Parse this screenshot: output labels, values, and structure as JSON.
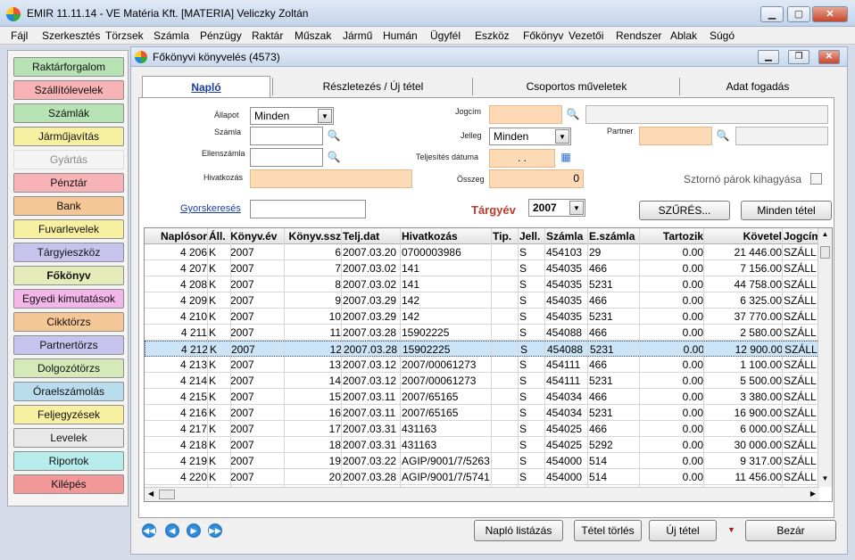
{
  "window": {
    "title": "EMIR 11.11.14 - VE Matéria Kft. [MATERIA] Veliczky Zoltán"
  },
  "menu": [
    "Fájl",
    "Szerkesztés",
    "Törzsek",
    "Számla",
    "Pénzügy",
    "Raktár",
    "Műszak",
    "Jármű",
    "Humán",
    "Ügyfél",
    "Eszköz",
    "Főkönyv",
    "Vezetői",
    "Rendszer",
    "Ablak",
    "Súgó"
  ],
  "nav": [
    {
      "label": "Raktárforgalom",
      "color": "#b7e3b4",
      "bold": false
    },
    {
      "label": "Szállítólevelek",
      "color": "#f7b3b6",
      "bold": false
    },
    {
      "label": "Számlák",
      "color": "#b7e3b4",
      "bold": false
    },
    {
      "label": "Járműjavítás",
      "color": "#f6f0a0",
      "bold": false
    },
    {
      "label": "Gyártás",
      "color": "#f4f4f4",
      "bold": false
    },
    {
      "label": "Pénztár",
      "color": "#f7b3b6",
      "bold": false
    },
    {
      "label": "Bank",
      "color": "#f5c796",
      "bold": false
    },
    {
      "label": "Fuvarlevelek",
      "color": "#f6f0a0",
      "bold": false
    },
    {
      "label": "Tárgyieszköz",
      "color": "#c8c3ec",
      "bold": false
    },
    {
      "label": "Főkönyv",
      "color": "#e6ecb9",
      "bold": true
    },
    {
      "label": "Egyedi kimutatások",
      "color": "#f3b6e9",
      "bold": false
    },
    {
      "label": "Cikktörzs",
      "color": "#f5c796",
      "bold": false
    },
    {
      "label": "Partnertörzs",
      "color": "#c8c3ec",
      "bold": false
    },
    {
      "label": "Dolgozótörzs",
      "color": "#d5eab8",
      "bold": false
    },
    {
      "label": "Óraelszámolás",
      "color": "#b9dded",
      "bold": false
    },
    {
      "label": "Feljegyzések",
      "color": "#f6f0a0",
      "bold": false
    },
    {
      "label": "Levelek",
      "color": "#e8e8e8",
      "bold": false
    },
    {
      "label": "Riportok",
      "color": "#b6ecec",
      "bold": false
    },
    {
      "label": "Kilépés",
      "color": "#f39898",
      "bold": false
    }
  ],
  "child": {
    "title": "Főkönyvi könyvelés (4573)"
  },
  "tabs": [
    "Napló",
    "Részletezés / Új tétel",
    "Csoportos  műveletek",
    "Adat fogadás"
  ],
  "form": {
    "allapot_label": "Állapot",
    "allapot_value": "Minden",
    "szamla_label": "Számla",
    "ellenszamla_label": "Ellenszámla",
    "hivatkozas_label": "Hivatkozás",
    "jogcim_label": "Jogcím",
    "jelleg_label": "Jelleg",
    "jelleg_value": "Minden",
    "teljesites_label": "Teljesítés dátuma",
    "teljesites_value": ". .",
    "osszeg_label": "Összeg",
    "osszeg_value": "0",
    "partner_label": "Partner",
    "sztorno_label": "Sztornó párok kihagyása",
    "gyorskereses": "Gyorskeresés",
    "targyev_label": "Tárgyév",
    "targyev_value": "2007",
    "szures_btn": "SZŰRÉS...",
    "minden_btn": "Minden tétel"
  },
  "grid": {
    "headers": [
      "Naplósor",
      "Áll.",
      "Könyv.év",
      "Könyv.ssz",
      "Telj.dat",
      "Hivatkozás",
      "Tip.",
      "Jell.",
      "Számla",
      "E.számla",
      "Tartozik",
      "Követel",
      "Jogcím"
    ],
    "rows": [
      [
        "4 206",
        "K",
        "2007",
        "6",
        "2007.03.20",
        "0700003986",
        "",
        "S",
        "454103",
        "29",
        "0.00",
        "21 446.00",
        "SZÁLL"
      ],
      [
        "4 207",
        "K",
        "2007",
        "7",
        "2007.03.02",
        "141",
        "",
        "S",
        "454035",
        "466",
        "0.00",
        "7 156.00",
        "SZÁLL"
      ],
      [
        "4 208",
        "K",
        "2007",
        "8",
        "2007.03.02",
        "141",
        "",
        "S",
        "454035",
        "5231",
        "0.00",
        "44 758.00",
        "SZÁLL"
      ],
      [
        "4 209",
        "K",
        "2007",
        "9",
        "2007.03.29",
        "142",
        "",
        "S",
        "454035",
        "466",
        "0.00",
        "6 325.00",
        "SZÁLL"
      ],
      [
        "4 210",
        "K",
        "2007",
        "10",
        "2007.03.29",
        "142",
        "",
        "S",
        "454035",
        "5231",
        "0.00",
        "37 770.00",
        "SZÁLL"
      ],
      [
        "4 211",
        "K",
        "2007",
        "11",
        "2007.03.28",
        "15902225",
        "",
        "S",
        "454088",
        "466",
        "0.00",
        "2 580.00",
        "SZÁLL"
      ],
      [
        "4 212",
        "K",
        "2007",
        "12",
        "2007.03.28",
        "15902225",
        "",
        "S",
        "454088",
        "5231",
        "0.00",
        "12 900.00",
        "SZÁLL"
      ],
      [
        "4 213",
        "K",
        "2007",
        "13",
        "2007.03.12",
        "2007/00061273",
        "",
        "S",
        "454111",
        "466",
        "0.00",
        "1 100.00",
        "SZÁLL"
      ],
      [
        "4 214",
        "K",
        "2007",
        "14",
        "2007.03.12",
        "2007/00061273",
        "",
        "S",
        "454111",
        "5231",
        "0.00",
        "5 500.00",
        "SZÁLL"
      ],
      [
        "4 215",
        "K",
        "2007",
        "15",
        "2007.03.11",
        "2007/65165",
        "",
        "S",
        "454034",
        "466",
        "0.00",
        "3 380.00",
        "SZÁLL"
      ],
      [
        "4 216",
        "K",
        "2007",
        "16",
        "2007.03.11",
        "2007/65165",
        "",
        "S",
        "454034",
        "5231",
        "0.00",
        "16 900.00",
        "SZÁLL"
      ],
      [
        "4 217",
        "K",
        "2007",
        "17",
        "2007.03.31",
        "431163",
        "",
        "S",
        "454025",
        "466",
        "0.00",
        "6 000.00",
        "SZÁLL"
      ],
      [
        "4 218",
        "K",
        "2007",
        "18",
        "2007.03.31",
        "431163",
        "",
        "S",
        "454025",
        "5292",
        "0.00",
        "30 000.00",
        "SZÁLL"
      ],
      [
        "4 219",
        "K",
        "2007",
        "19",
        "2007.03.22",
        "AGIP/9001/7/5263",
        "",
        "S",
        "454000",
        "514",
        "0.00",
        "9 317.00",
        "SZÁLL"
      ],
      [
        "4 220",
        "K",
        "2007",
        "20",
        "2007.03.28",
        "AGIP/9001/7/5741",
        "",
        "S",
        "454000",
        "514",
        "0.00",
        "11 456.00",
        "SZÁLL"
      ]
    ],
    "selected_index": 6
  },
  "bottom": {
    "naplo_btn": "Napló listázás",
    "torles_btn": "Tétel törlés",
    "uj_btn": "Új tétel",
    "bezar_btn": "Bezár"
  }
}
